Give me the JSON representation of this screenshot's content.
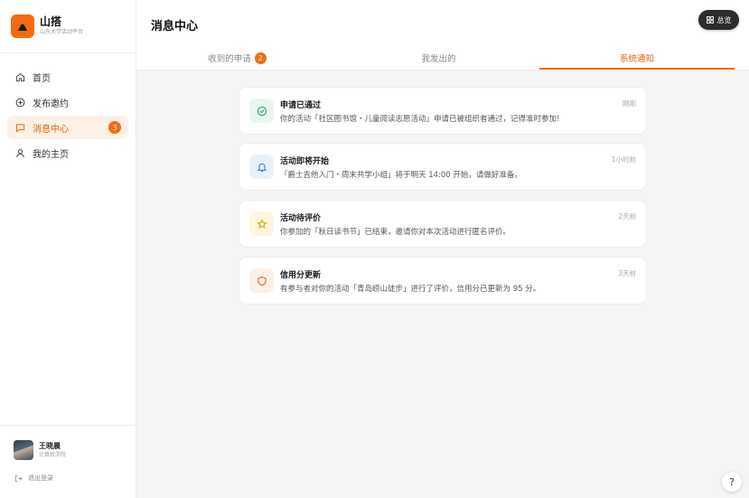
{
  "brand": {
    "name": "山搭",
    "subtitle": "山东大学活动平台",
    "logo_icon": "mountain-icon",
    "accent": "#f26c0f"
  },
  "sidebar": {
    "items": [
      {
        "label": "首页",
        "icon": "home-icon"
      },
      {
        "label": "发布邀约",
        "icon": "plus-circle-icon"
      },
      {
        "label": "消息中心",
        "icon": "message-icon",
        "badge": "3",
        "active": true
      },
      {
        "label": "我的主页",
        "icon": "user-icon"
      }
    ]
  },
  "user": {
    "name": "王晓晨",
    "dept": "计算机学院"
  },
  "logout_label": "退出登录",
  "header": {
    "title": "消息中心",
    "overview_label": "总览"
  },
  "tabs": [
    {
      "label": "收到的申请",
      "badge": "2"
    },
    {
      "label": "我发出的"
    },
    {
      "label": "系统通知",
      "active": true
    }
  ],
  "notifications": [
    {
      "title": "申请已通过",
      "body": "你的活动「社区图书馆・儿童阅读志愿活动」申请已被组织者通过，记得准时参加!",
      "time": "刚刚",
      "icon": "check-circle-icon",
      "color": "#2e9e68",
      "bg": "#e8f6ee"
    },
    {
      "title": "活动即将开始",
      "body": "「爵士吉他入门・周末共学小组」将于明天 14:00 开始，请做好准备。",
      "time": "1小时前",
      "icon": "bell-icon",
      "color": "#3b82c4",
      "bg": "#e8f1fb"
    },
    {
      "title": "活动待评价",
      "body": "你参加的「秋日读书节」已结束，邀请你对本次活动进行匿名评价。",
      "time": "2天前",
      "icon": "star-icon",
      "color": "#e0a800",
      "bg": "#fdf6e0"
    },
    {
      "title": "信用分更新",
      "body": "有参与者对你的活动「青岛崂山徒步」进行了评价，信用分已更新为 95 分。",
      "time": "3天前",
      "icon": "shield-icon",
      "color": "#e8630d",
      "bg": "#fdf0e6"
    }
  ],
  "help_label": "?"
}
